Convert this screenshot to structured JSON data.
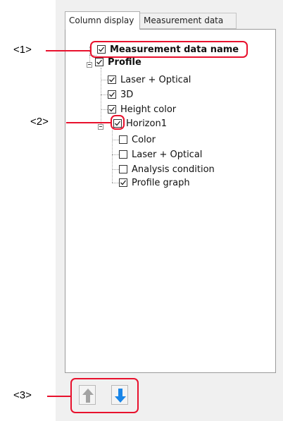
{
  "tabs": [
    {
      "label": "Column display"
    },
    {
      "label": "Measurement data"
    }
  ],
  "tree": {
    "root": {
      "label": "Measurement data name",
      "checked": true
    },
    "profile": {
      "label": "Profile",
      "checked": true
    },
    "items": [
      {
        "label": "Laser + Optical",
        "checked": true
      },
      {
        "label": "3D",
        "checked": true
      },
      {
        "label": "Height color",
        "checked": true
      },
      {
        "label": "Horizon1",
        "checked": true
      }
    ],
    "horizon_children": [
      {
        "label": "Color",
        "checked": false
      },
      {
        "label": "Laser + Optical",
        "checked": false
      },
      {
        "label": "Analysis condition",
        "checked": false
      },
      {
        "label": "Profile graph",
        "checked": true
      }
    ]
  },
  "callouts": [
    {
      "label": "<1>"
    },
    {
      "label": "<2>"
    },
    {
      "label": "<3>"
    }
  ],
  "buttons": {
    "move_up": {
      "icon": "arrow-up-icon",
      "enabled": false,
      "color": "#9e9e9e"
    },
    "move_down": {
      "icon": "arrow-down-icon",
      "enabled": true,
      "color": "#1a86e8"
    }
  },
  "colors": {
    "callout": "#e8112d",
    "panel_bg": "#f0f0f0"
  }
}
